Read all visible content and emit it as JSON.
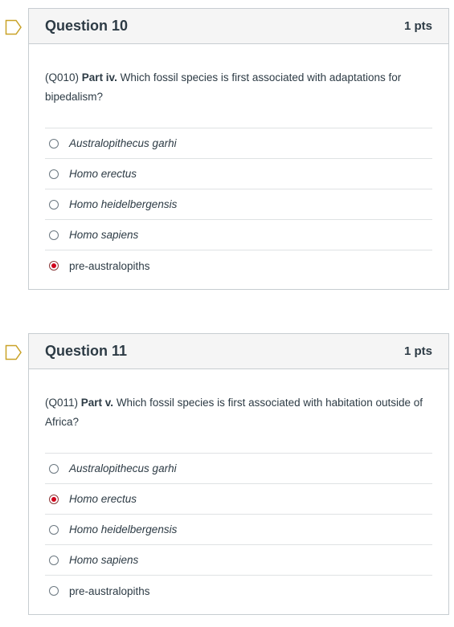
{
  "questions": [
    {
      "title": "Question 10",
      "points": "1 pts",
      "code": "(Q010)",
      "part": "Part iv.",
      "text": " Which fossil species is first associated with adaptations for bipedalism?",
      "answers": [
        {
          "label": "Australopithecus garhi",
          "selected": false
        },
        {
          "label": "Homo erectus",
          "selected": false
        },
        {
          "label": "Homo heidelbergensis",
          "selected": false
        },
        {
          "label": "Homo sapiens",
          "selected": false
        },
        {
          "label": "pre-australopiths",
          "selected": true
        }
      ]
    },
    {
      "title": "Question 11",
      "points": "1 pts",
      "code": "(Q011)",
      "part": "Part v.",
      "text": " Which fossil species is first associated with habitation outside of Africa?",
      "answers": [
        {
          "label": "Australopithecus garhi",
          "selected": false
        },
        {
          "label": "Homo erectus",
          "selected": true
        },
        {
          "label": "Homo heidelbergensis",
          "selected": false
        },
        {
          "label": "Homo sapiens",
          "selected": false
        },
        {
          "label": "pre-australopiths",
          "selected": false
        }
      ]
    }
  ],
  "colors": {
    "accent": "#d0021b",
    "border": "#c7cdd1",
    "header_bg": "#f5f5f5",
    "text": "#2d3b45"
  }
}
